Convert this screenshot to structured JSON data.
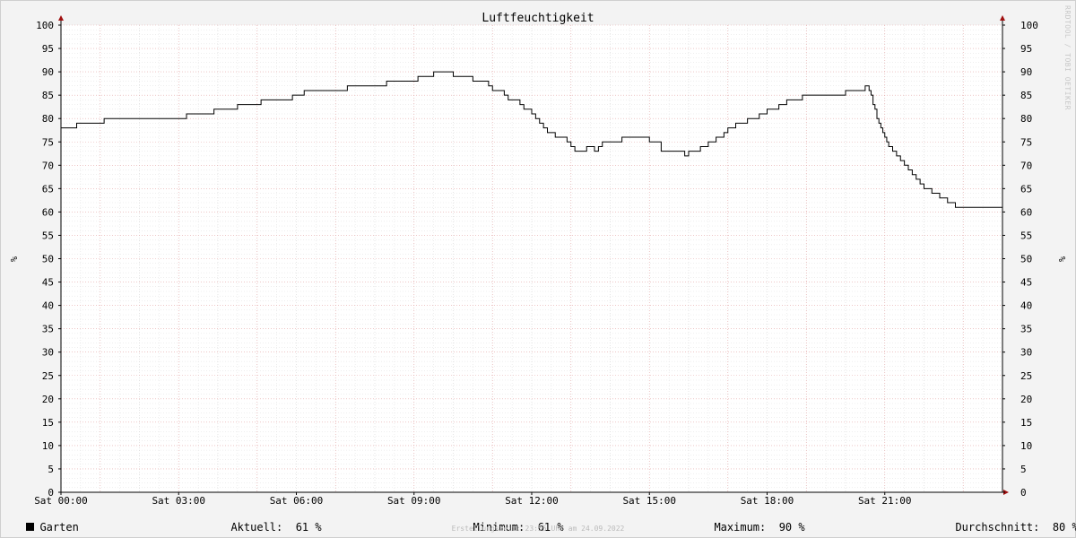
{
  "chart_data": {
    "type": "line",
    "title": "Luftfeuchtigkeit",
    "ylabel_left": "%",
    "ylabel_right": "%",
    "ylim": [
      0,
      100
    ],
    "y_ticks": [
      0,
      5,
      10,
      15,
      20,
      25,
      30,
      35,
      40,
      45,
      50,
      55,
      60,
      65,
      70,
      75,
      80,
      85,
      90,
      95,
      100
    ],
    "x_tick_labels": [
      "Sat 00:00",
      "Sat 03:00",
      "Sat 06:00",
      "Sat 09:00",
      "Sat 12:00",
      "Sat 15:00",
      "Sat 18:00",
      "Sat 21:00"
    ],
    "x_hours_range": [
      0,
      24
    ],
    "grid": true,
    "series": [
      {
        "name": "Garten",
        "color": "#000000",
        "x_hours": [
          0.0,
          0.35,
          0.4,
          1.0,
          1.1,
          2.0,
          2.5,
          3.0,
          3.2,
          3.5,
          3.9,
          4.2,
          4.5,
          5.1,
          5.5,
          5.9,
          6.2,
          6.9,
          7.3,
          8.0,
          8.3,
          8.9,
          9.1,
          9.4,
          9.5,
          9.8,
          10.0,
          10.4,
          10.5,
          10.7,
          10.9,
          11.0,
          11.1,
          11.3,
          11.4,
          11.6,
          11.7,
          11.8,
          12.0,
          12.1,
          12.2,
          12.3,
          12.4,
          12.5,
          12.6,
          12.8,
          12.9,
          13.0,
          13.1,
          13.2,
          13.3,
          13.4,
          13.5,
          13.6,
          13.7,
          13.8,
          14.0,
          14.3,
          14.8,
          15.0,
          15.3,
          15.5,
          15.6,
          15.9,
          16.0,
          16.2,
          16.3,
          16.4,
          16.5,
          16.6,
          16.7,
          16.8,
          16.9,
          17.0,
          17.2,
          17.5,
          17.8,
          18.0,
          18.3,
          18.5,
          18.9,
          19.2,
          19.8,
          20.0,
          20.5,
          20.6,
          20.65,
          20.7,
          20.75,
          20.8,
          20.85,
          20.9,
          20.95,
          21.0,
          21.05,
          21.1,
          21.2,
          21.3,
          21.4,
          21.5,
          21.6,
          21.7,
          21.8,
          21.9,
          22.0,
          22.2,
          22.4,
          22.6,
          22.8,
          23.0,
          23.2,
          23.5,
          23.7,
          23.99
        ],
        "values": [
          78,
          78,
          79,
          79,
          80,
          80,
          80,
          80,
          81,
          81,
          82,
          82,
          83,
          84,
          84,
          85,
          86,
          86,
          87,
          87,
          88,
          88,
          89,
          89,
          90,
          90,
          89,
          89,
          88,
          88,
          87,
          86,
          86,
          85,
          84,
          84,
          83,
          82,
          81,
          80,
          79,
          78,
          77,
          77,
          76,
          76,
          75,
          74,
          73,
          73,
          73,
          74,
          74,
          73,
          74,
          75,
          75,
          76,
          76,
          75,
          73,
          73,
          73,
          72,
          73,
          73,
          74,
          74,
          75,
          75,
          76,
          76,
          77,
          78,
          79,
          80,
          81,
          82,
          83,
          84,
          85,
          85,
          85,
          86,
          87,
          86,
          85,
          83,
          82,
          80,
          79,
          78,
          77,
          76,
          75,
          74,
          73,
          72,
          71,
          70,
          69,
          68,
          67,
          66,
          65,
          64,
          63,
          62,
          61,
          61,
          61,
          61,
          61,
          61,
          61,
          61
        ],
        "current": 61,
        "minimum": 61,
        "maximum": 90,
        "average": 80
      }
    ]
  },
  "legend": {
    "series_name": "Garten",
    "current_label": "Aktuell:",
    "current_value": "61 %",
    "min_label": "Minimum:",
    "min_value": "61 %",
    "max_label": "Maximum:",
    "max_value": "90 %",
    "avg_label": "Durchschnitt:",
    "avg_value": "80 %"
  },
  "footer": "Erstellungszeit: 23:55 Uhr am 24.09.2022",
  "watermark": "RRDTOOL / TOBI OETIKER"
}
